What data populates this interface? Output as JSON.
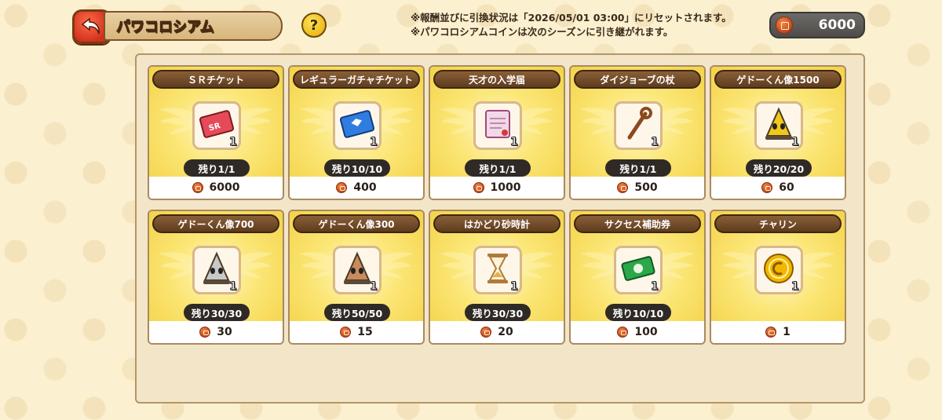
{
  "header": {
    "title": "パワコロシアム",
    "help_label": "?",
    "notice_line1": "※報酬並びに引換状況は「2026/05/01 03:00」にリセットされます。",
    "notice_line2": "※パワコロシアムコインは次のシーズンに引き継がれます。",
    "coin_amount": "6000"
  },
  "items": [
    {
      "name": "ＳＲチケット",
      "qty": "1",
      "remain": "残り1/1",
      "price": "6000",
      "icon": "sr-ticket-icon",
      "color": "#e64a5a"
    },
    {
      "name": "レギュラーガチャチケット",
      "qty": "1",
      "remain": "残り10/10",
      "price": "400",
      "icon": "regular-ticket-icon",
      "color": "#2f7de0"
    },
    {
      "name": "天才の入学届",
      "qty": "1",
      "remain": "残り1/1",
      "price": "1000",
      "icon": "scroll-icon",
      "color": "#f0d8e8"
    },
    {
      "name": "ダイジョーブの杖",
      "qty": "1",
      "remain": "残り1/1",
      "price": "500",
      "icon": "staff-icon",
      "color": "#8a4a1e"
    },
    {
      "name": "ゲドーくん像1500",
      "qty": "1",
      "remain": "残り20/20",
      "price": "60",
      "icon": "gedo-statue-gold-icon",
      "color": "#f2c81a"
    },
    {
      "name": "ゲドーくん像700",
      "qty": "1",
      "remain": "残り30/30",
      "price": "30",
      "icon": "gedo-statue-silver-icon",
      "color": "#c8c8c8"
    },
    {
      "name": "ゲドーくん像300",
      "qty": "1",
      "remain": "残り50/50",
      "price": "15",
      "icon": "gedo-statue-bronze-icon",
      "color": "#c98a5e"
    },
    {
      "name": "はかどり砂時計",
      "qty": "1",
      "remain": "残り30/30",
      "price": "20",
      "icon": "hourglass-icon",
      "color": "#b07a3a"
    },
    {
      "name": "サクセス補助券",
      "qty": "1",
      "remain": "残り10/10",
      "price": "100",
      "icon": "success-ticket-icon",
      "color": "#2aa84a"
    },
    {
      "name": "チャリン",
      "qty": "1",
      "remain": "",
      "price": "1",
      "icon": "gold-coin-icon",
      "color": "#f2b600"
    }
  ]
}
